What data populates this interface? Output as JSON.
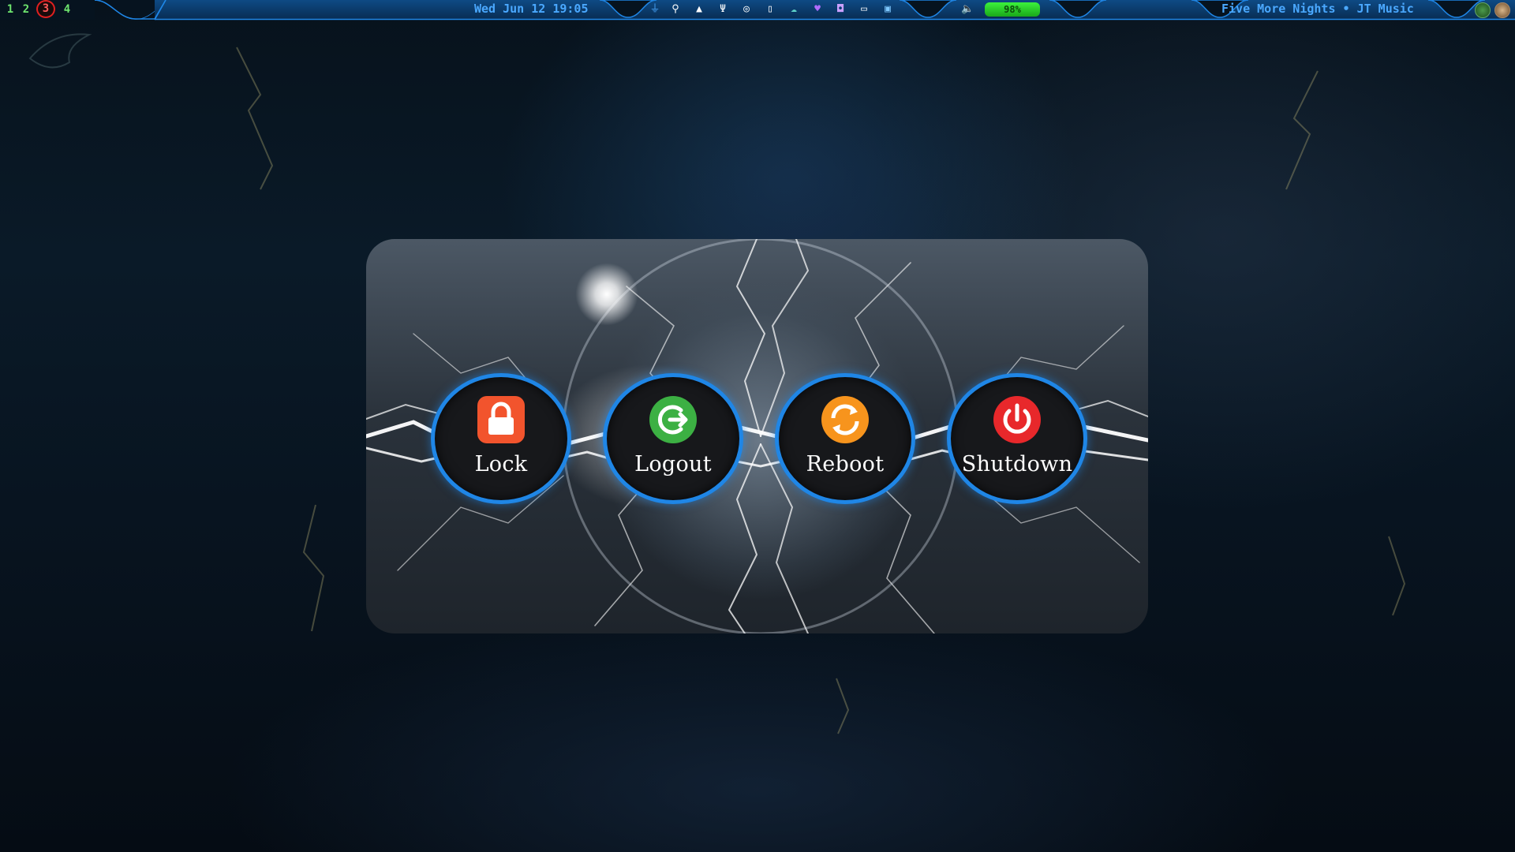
{
  "topbar": {
    "workspaces": [
      "1",
      "2",
      "3",
      "4"
    ],
    "active_workspace": "3",
    "datetime": "Wed Jun 12 19:05",
    "tray_icons": [
      "network-icon",
      "pin-icon",
      "ghost-icon",
      "usb-icon",
      "globe-icon",
      "phone-icon",
      "cloud-icon",
      "heart-icon",
      "shield-icon",
      "window-icon",
      "document-icon"
    ],
    "battery": "98%",
    "now_playing": "Five More Nights • JT Music",
    "colors": {
      "bar": "#0c3d6e",
      "accent": "#1f86e6",
      "text": "#4aa8ff",
      "workspace": "#6ee56e",
      "active_workspace": "#ff5a5a"
    }
  },
  "power_menu": {
    "buttons": [
      {
        "id": "lock",
        "label": "Lock",
        "icon": "lock-icon",
        "color": "#f2542d"
      },
      {
        "id": "logout",
        "label": "Logout",
        "icon": "logout-icon",
        "color": "#3cb043"
      },
      {
        "id": "reboot",
        "label": "Reboot",
        "icon": "reboot-icon",
        "color": "#f7941d"
      },
      {
        "id": "shutdown",
        "label": "Shutdown",
        "icon": "power-icon",
        "color": "#e8282b"
      }
    ],
    "border_color": "#1f86e6"
  }
}
